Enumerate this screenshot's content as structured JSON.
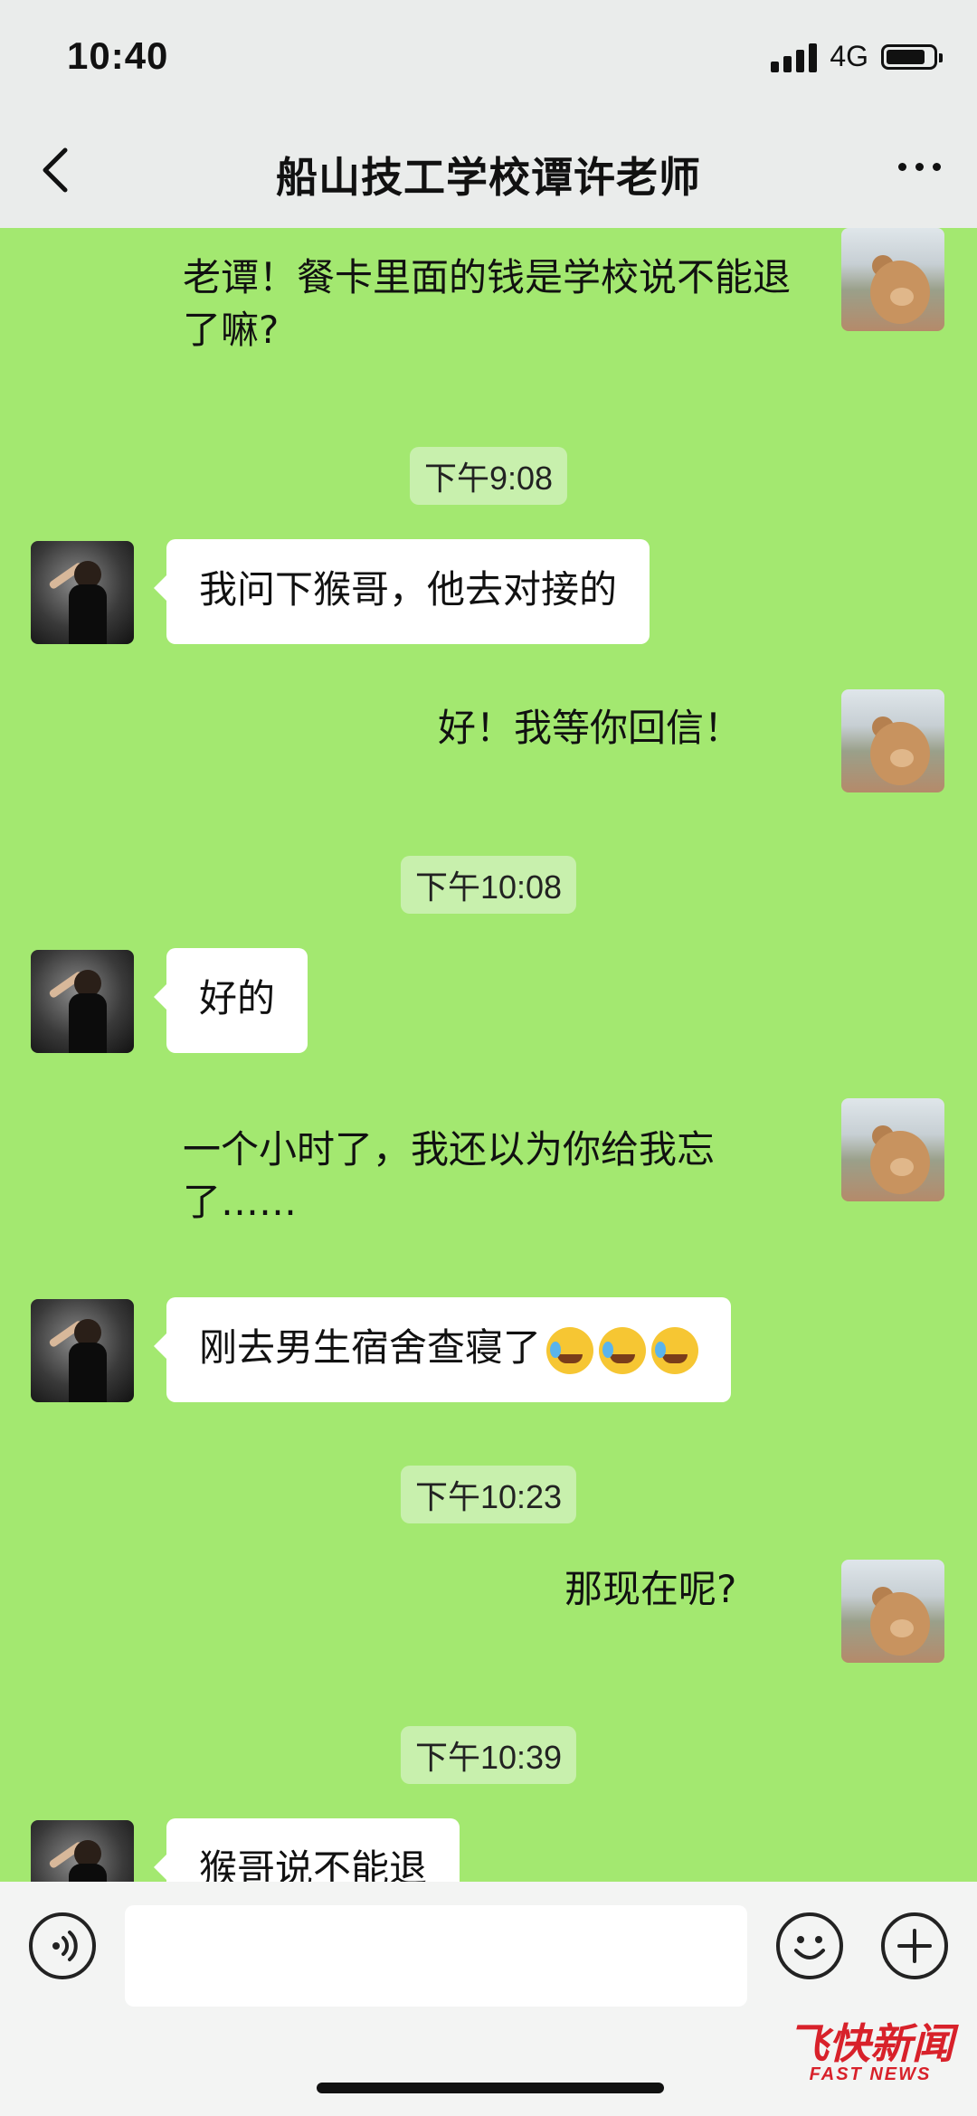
{
  "status_bar": {
    "time": "10:40",
    "network": "4G"
  },
  "header": {
    "title": "船山技工学校谭许老师"
  },
  "messages": {
    "m1": "老谭！餐卡里面的钱是学校说不能退了嘛?",
    "ts1": "下午9:08",
    "m2": "我问下猴哥，他去对接的",
    "m3": "好！我等你回信！",
    "ts2": "下午10:08",
    "m4": "好的",
    "m5": "一个小时了，我还以为你给我忘了……",
    "m6": "刚去男生宿舍查寝了",
    "ts3": "下午10:23",
    "m7": "那现在呢?",
    "ts4": "下午10:39",
    "m8": "猴哥说不能退"
  },
  "emoji_names": [
    "loudly-crying-face",
    "loudly-crying-face",
    "loudly-crying-face"
  ],
  "icons": {
    "back": "chevron-left-icon",
    "more": "more-dots-icon",
    "voice": "voice-icon",
    "emoji": "smiley-icon",
    "plus": "plus-icon"
  },
  "watermark": {
    "main": "飞快新闻",
    "sub": "FAST NEWS"
  },
  "colors": {
    "chat_background": "#a3e870",
    "timestamp_bg": "#c8f0ad",
    "watermark": "#d8212a"
  }
}
